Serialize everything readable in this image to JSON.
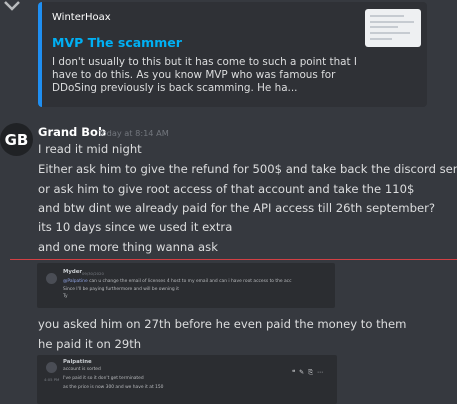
{
  "embed": {
    "author": "WinterHoax",
    "title": "MVP The scammer",
    "description": "I don't usually to this but it has come to such a point that I have to do this. As you know MVP who was famous for DDoSing previously is back scamming. He ha..."
  },
  "message": {
    "avatar_initials": "GB",
    "author": "Grand Bob",
    "timestamp": "Today at 8:14 AM",
    "lines": [
      "I read it mid night",
      "Either ask him to give the refund for 500$ and take back the discord server",
      "or ask him to give root access of that account and take the 110$",
      "and btw dint we already paid for the API access till 26th september?",
      "its 10 days since we used it extra",
      "and one more thing wanna ask"
    ],
    "lines_after_shot1": [
      "you asked him on 27th before he even paid the money to them",
      "he paid it on 29th"
    ]
  },
  "screenshot1": {
    "author": "Myder",
    "time": "09/30/2020",
    "mention": "@Palpatine",
    "line1": "can u change the email of licenses 4 host to my email and can i have root access to the acc",
    "line2": "Since I'll be paying furthermore and will be owning it",
    "line3": "Ty"
  },
  "screenshot2": {
    "author": "Palpatine",
    "side_time": "4:05 PM",
    "line1": "account is sorted",
    "line2": "I've paid it so it don't get terminated",
    "line3": "as the price is now 300 and we have it at 150"
  },
  "icons": [
    "chevron-down-icon",
    "thumbnail-image"
  ]
}
